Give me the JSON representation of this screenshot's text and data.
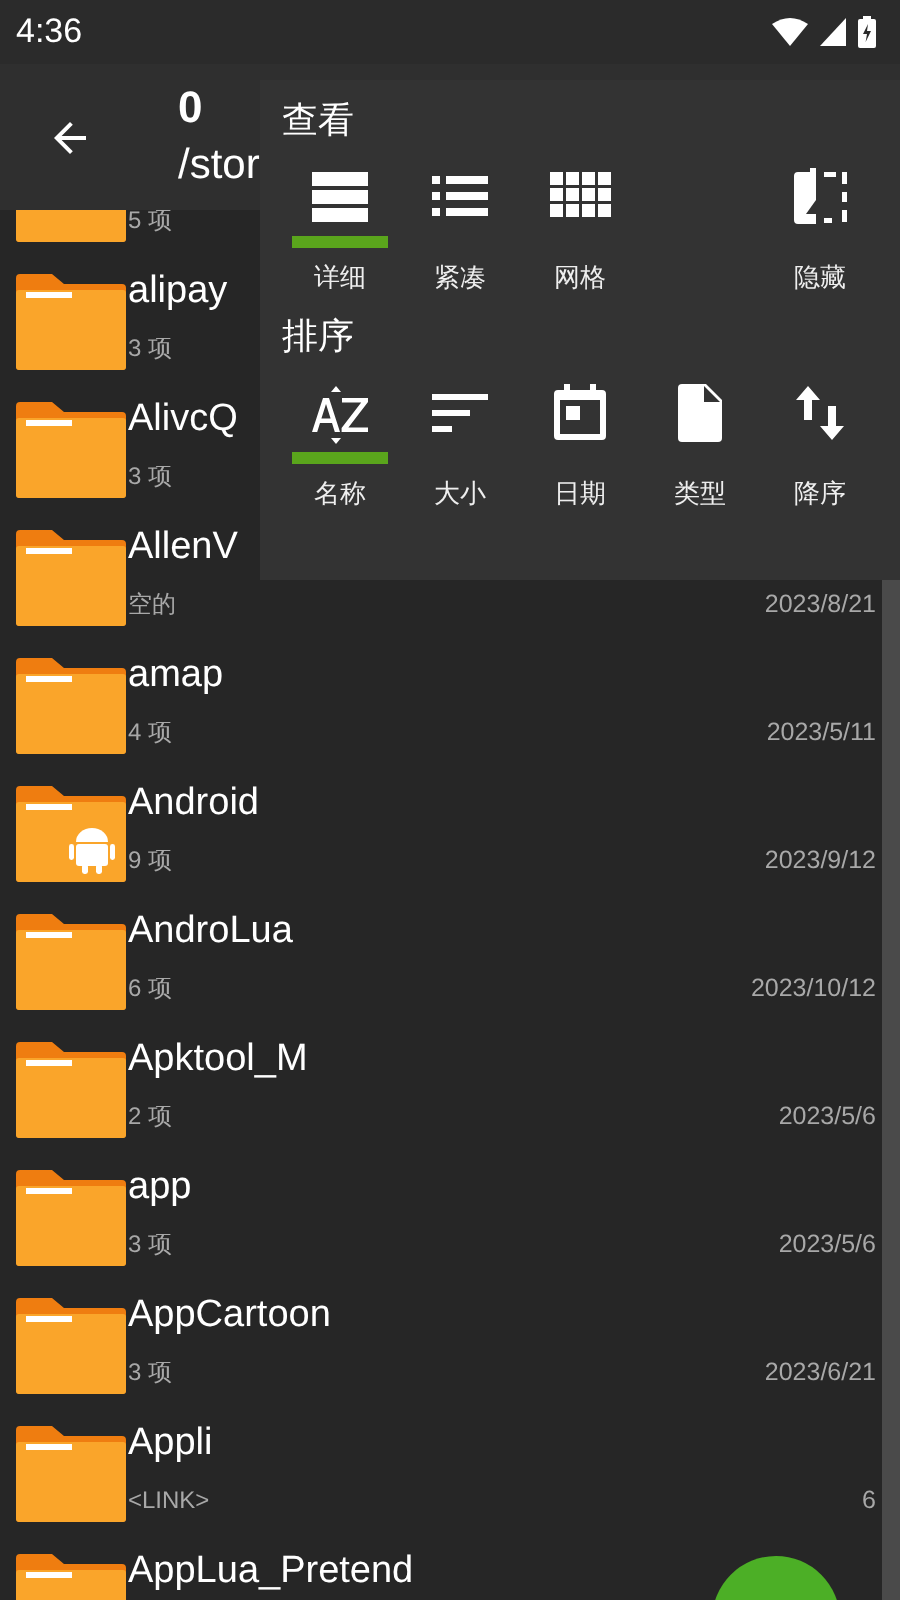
{
  "status_bar": {
    "time": "4:36"
  },
  "toolbar": {
    "title": "0",
    "path": "/stor"
  },
  "files": [
    {
      "kind": "folder",
      "info": "5 项"
    },
    {
      "kind": "folder",
      "name": "alipay",
      "info": "3 项"
    },
    {
      "kind": "folder",
      "name": "AlivcQ",
      "info": "3 项"
    },
    {
      "kind": "folder",
      "name": "AllenV",
      "info": "空的",
      "date": "2023/8/21"
    },
    {
      "kind": "folder",
      "name": "amap",
      "info": "4 项",
      "date": "2023/5/11"
    },
    {
      "kind": "android",
      "name": "Android",
      "info": "9 项",
      "date": "2023/9/12"
    },
    {
      "kind": "folder",
      "name": "AndroLua",
      "info": "6 项",
      "date": "2023/10/12"
    },
    {
      "kind": "folder",
      "name": "Apktool_M",
      "info": "2 项",
      "date": "2023/5/6"
    },
    {
      "kind": "folder",
      "name": "app",
      "info": "3 项",
      "date": "2023/5/6"
    },
    {
      "kind": "folder",
      "name": "AppCartoon",
      "info": "3 项",
      "date": "2023/6/21"
    },
    {
      "kind": "folder",
      "name": "Appli",
      "info": "<LINK>",
      "date": "6"
    },
    {
      "kind": "folder",
      "name": "AppLua_Pretend"
    }
  ],
  "menu": {
    "view_title": "查看",
    "view": [
      {
        "kind": "details",
        "label": "详细",
        "selected": true
      },
      {
        "kind": "compact",
        "label": "紧凑",
        "selected": false
      },
      {
        "kind": "grid",
        "label": "网格",
        "selected": false
      },
      {
        "kind": "hidden",
        "label": "隐藏",
        "selected": false
      }
    ],
    "sort_title": "排序",
    "sort": [
      {
        "kind": "name",
        "label": "名称",
        "selected": true
      },
      {
        "kind": "size",
        "label": "大小",
        "selected": false
      },
      {
        "kind": "date",
        "label": "日期",
        "selected": false
      },
      {
        "kind": "type",
        "label": "类型",
        "selected": false
      },
      {
        "kind": "order",
        "label": "降序",
        "selected": false
      }
    ]
  }
}
